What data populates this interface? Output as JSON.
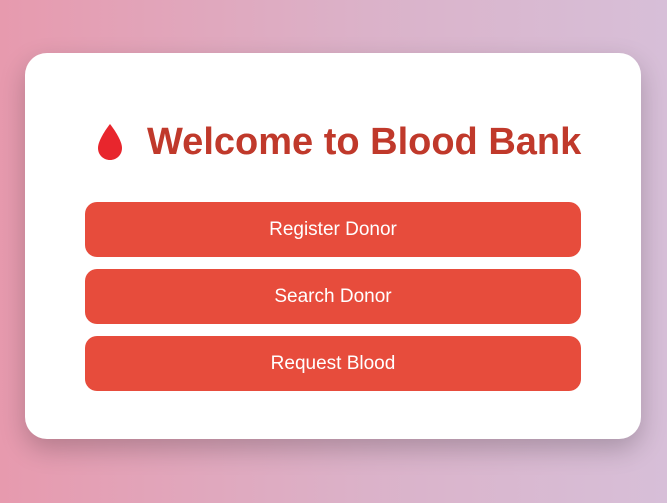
{
  "page": {
    "title": "Welcome to Blood Bank",
    "icon": "blood-drop-icon",
    "colors": {
      "title": "#c0392b",
      "button": "#e74c3c",
      "drop": "#e8262d"
    }
  },
  "actions": {
    "register_label": "Register Donor",
    "search_label": "Search Donor",
    "request_label": "Request Blood"
  }
}
